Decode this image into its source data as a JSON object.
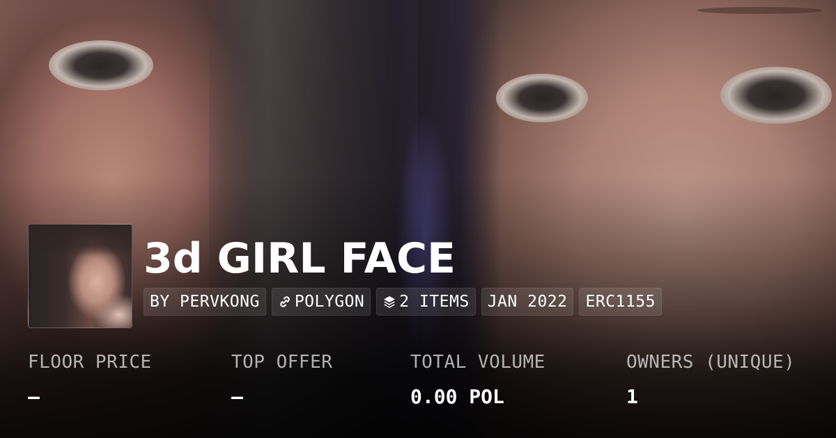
{
  "collection": {
    "title": "3d GIRL FACE"
  },
  "chips": {
    "creator": "BY PERVKONG",
    "chain": "POLYGON",
    "chain_icon": "link-icon",
    "items": "2 ITEMS",
    "items_icon": "layers-icon",
    "date": "JAN 2022",
    "standard": "ERC1155"
  },
  "stats": {
    "floor_price": {
      "label": "FLOOR PRICE",
      "value": "–"
    },
    "top_offer": {
      "label": "TOP OFFER",
      "value": "–"
    },
    "total_volume": {
      "label": "TOTAL VOLUME",
      "value": "0.00 POL"
    },
    "owners": {
      "label": "OWNERS (UNIQUE)",
      "value": "1"
    }
  },
  "colors": {
    "text_primary": "#ffffff",
    "text_secondary": "#b3b3b3",
    "chip_background": "#ffffff1a"
  }
}
